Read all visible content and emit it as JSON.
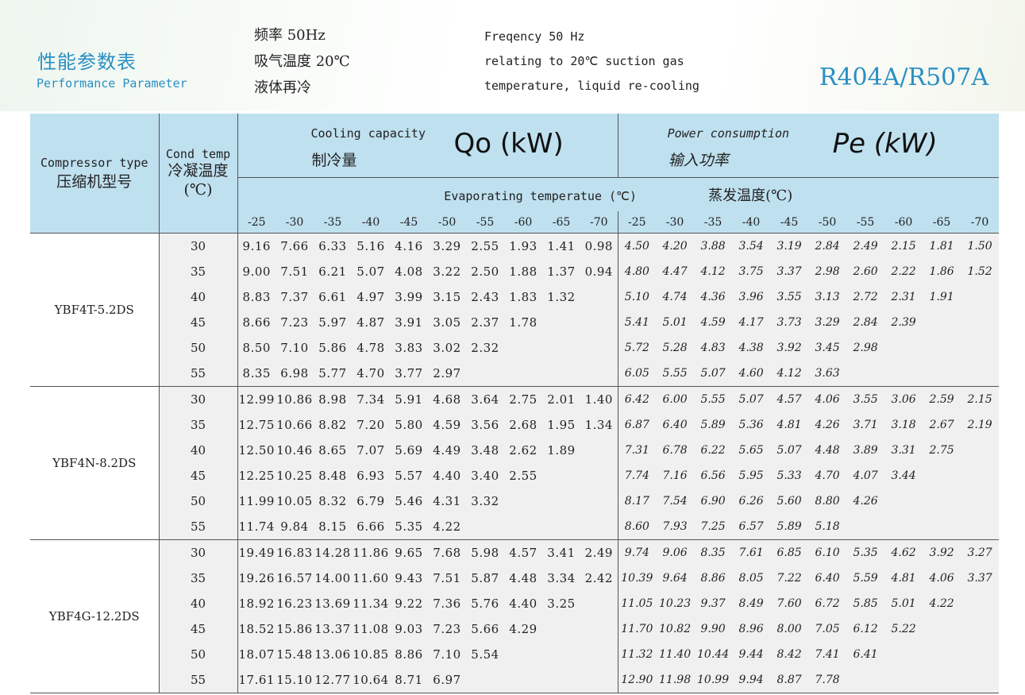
{
  "header": {
    "title_cn": "性能参数表",
    "title_en": "Performance Parameter",
    "conditions_cn": [
      "频率 50Hz",
      "吸气温度 20℃",
      "液体再冷"
    ],
    "conditions_en": [
      "Freqency 50 Hz",
      "relating to 20℃ suction gas",
      "temperature, liquid re-cooling"
    ],
    "refrigerant": "R404A/R507A"
  },
  "table": {
    "compressor_type_en": "Compressor type",
    "compressor_type_cn": "压缩机型号",
    "cond_temp_en": "Cond temp",
    "cond_temp_cn": "冷凝温度",
    "cond_temp_unit": "(℃)",
    "cooling_en": "Cooling capacity",
    "cooling_cn": "制冷量",
    "cooling_symbol": "Qo (kW)",
    "power_en": "Power consumption",
    "power_cn": "输入功率",
    "power_symbol": "Pe (kW)",
    "evap_en": "Evaporating temperatue (℃)",
    "evap_cn": "蒸发温度(℃)",
    "evap_temps": [
      "-25",
      "-30",
      "-35",
      "-40",
      "-45",
      "-50",
      "-55",
      "-60",
      "-65",
      "-70"
    ],
    "models": [
      {
        "name": "YBF4T-5.2DS",
        "rows": [
          {
            "t": "30",
            "q": [
              "9.16",
              "7.66",
              "6.33",
              "5.16",
              "4.16",
              "3.29",
              "2.55",
              "1.93",
              "1.41",
              "0.98"
            ],
            "p": [
              "4.50",
              "4.20",
              "3.88",
              "3.54",
              "3.19",
              "2.84",
              "2.49",
              "2.15",
              "1.81",
              "1.50"
            ]
          },
          {
            "t": "35",
            "q": [
              "9.00",
              "7.51",
              "6.21",
              "5.07",
              "4.08",
              "3.22",
              "2.50",
              "1.88",
              "1.37",
              "0.94"
            ],
            "p": [
              "4.80",
              "4.47",
              "4.12",
              "3.75",
              "3.37",
              "2.98",
              "2.60",
              "2.22",
              "1.86",
              "1.52"
            ]
          },
          {
            "t": "40",
            "q": [
              "8.83",
              "7.37",
              "6.61",
              "4.97",
              "3.99",
              "3.15",
              "2.43",
              "1.83",
              "1.32",
              ""
            ],
            "p": [
              "5.10",
              "4.74",
              "4.36",
              "3.96",
              "3.55",
              "3.13",
              "2.72",
              "2.31",
              "1.91",
              ""
            ]
          },
          {
            "t": "45",
            "q": [
              "8.66",
              "7.23",
              "5.97",
              "4.87",
              "3.91",
              "3.05",
              "2.37",
              "1.78",
              "",
              ""
            ],
            "p": [
              "5.41",
              "5.01",
              "4.59",
              "4.17",
              "3.73",
              "3.29",
              "2.84",
              "2.39",
              "",
              ""
            ]
          },
          {
            "t": "50",
            "q": [
              "8.50",
              "7.10",
              "5.86",
              "4.78",
              "3.83",
              "3.02",
              "2.32",
              "",
              "",
              ""
            ],
            "p": [
              "5.72",
              "5.28",
              "4.83",
              "4.38",
              "3.92",
              "3.45",
              "2.98",
              "",
              "",
              ""
            ]
          },
          {
            "t": "55",
            "q": [
              "8.35",
              "6.98",
              "5.77",
              "4.70",
              "3.77",
              "2.97",
              "",
              "",
              "",
              ""
            ],
            "p": [
              "6.05",
              "5.55",
              "5.07",
              "4.60",
              "4.12",
              "3.63",
              "",
              "",
              "",
              ""
            ]
          }
        ]
      },
      {
        "name": "YBF4N-8.2DS",
        "rows": [
          {
            "t": "30",
            "q": [
              "12.99",
              "10.86",
              "8.98",
              "7.34",
              "5.91",
              "4.68",
              "3.64",
              "2.75",
              "2.01",
              "1.40"
            ],
            "p": [
              "6.42",
              "6.00",
              "5.55",
              "5.07",
              "4.57",
              "4.06",
              "3.55",
              "3.06",
              "2.59",
              "2.15"
            ]
          },
          {
            "t": "35",
            "q": [
              "12.75",
              "10.66",
              "8.82",
              "7.20",
              "5.80",
              "4.59",
              "3.56",
              "2.68",
              "1.95",
              "1.34"
            ],
            "p": [
              "6.87",
              "6.40",
              "5.89",
              "5.36",
              "4.81",
              "4.26",
              "3.71",
              "3.18",
              "2.67",
              "2.19"
            ]
          },
          {
            "t": "40",
            "q": [
              "12.50",
              "10.46",
              "8.65",
              "7.07",
              "5.69",
              "4.49",
              "3.48",
              "2.62",
              "1.89",
              ""
            ],
            "p": [
              "7.31",
              "6.78",
              "6.22",
              "5.65",
              "5.07",
              "4.48",
              "3.89",
              "3.31",
              "2.75",
              ""
            ]
          },
          {
            "t": "45",
            "q": [
              "12.25",
              "10.25",
              "8.48",
              "6.93",
              "5.57",
              "4.40",
              "3.40",
              "2.55",
              "",
              ""
            ],
            "p": [
              "7.74",
              "7.16",
              "6.56",
              "5.95",
              "5.33",
              "4.70",
              "4.07",
              "3.44",
              "",
              ""
            ]
          },
          {
            "t": "50",
            "q": [
              "11.99",
              "10.05",
              "8.32",
              "6.79",
              "5.46",
              "4.31",
              "3.32",
              "",
              "",
              ""
            ],
            "p": [
              "8.17",
              "7.54",
              "6.90",
              "6.26",
              "5.60",
              "8.80",
              "4.26",
              "",
              "",
              ""
            ]
          },
          {
            "t": "55",
            "q": [
              "11.74",
              "9.84",
              "8.15",
              "6.66",
              "5.35",
              "4.22",
              "",
              "",
              "",
              ""
            ],
            "p": [
              "8.60",
              "7.93",
              "7.25",
              "6.57",
              "5.89",
              "5.18",
              "",
              "",
              "",
              ""
            ]
          }
        ]
      },
      {
        "name": "YBF4G-12.2DS",
        "rows": [
          {
            "t": "30",
            "q": [
              "19.49",
              "16.83",
              "14.28",
              "11.86",
              "9.65",
              "7.68",
              "5.98",
              "4.57",
              "3.41",
              "2.49"
            ],
            "p": [
              "9.74",
              "9.06",
              "8.35",
              "7.61",
              "6.85",
              "6.10",
              "5.35",
              "4.62",
              "3.92",
              "3.27"
            ]
          },
          {
            "t": "35",
            "q": [
              "19.26",
              "16.57",
              "14.00",
              "11.60",
              "9.43",
              "7.51",
              "5.87",
              "4.48",
              "3.34",
              "2.42"
            ],
            "p": [
              "10.39",
              "9.64",
              "8.86",
              "8.05",
              "7.22",
              "6.40",
              "5.59",
              "4.81",
              "4.06",
              "3.37"
            ]
          },
          {
            "t": "40",
            "q": [
              "18.92",
              "16.23",
              "13.69",
              "11.34",
              "9.22",
              "7.36",
              "5.76",
              "4.40",
              "3.25",
              ""
            ],
            "p": [
              "11.05",
              "10.23",
              "9.37",
              "8.49",
              "7.60",
              "6.72",
              "5.85",
              "5.01",
              "4.22",
              ""
            ]
          },
          {
            "t": "45",
            "q": [
              "18.52",
              "15.86",
              "13.37",
              "11.08",
              "9.03",
              "7.23",
              "5.66",
              "4.29",
              "",
              ""
            ],
            "p": [
              "11.70",
              "10.82",
              "9.90",
              "8.96",
              "8.00",
              "7.05",
              "6.12",
              "5.22",
              "",
              ""
            ]
          },
          {
            "t": "50",
            "q": [
              "18.07",
              "15.48",
              "13.06",
              "10.85",
              "8.86",
              "7.10",
              "5.54",
              "",
              "",
              ""
            ],
            "p": [
              "11.32",
              "11.40",
              "10.44",
              "9.44",
              "8.42",
              "7.41",
              "6.41",
              "",
              "",
              ""
            ]
          },
          {
            "t": "55",
            "q": [
              "17.61",
              "15.10",
              "12.77",
              "10.64",
              "8.71",
              "6.97",
              "",
              "",
              "",
              ""
            ],
            "p": [
              "12.90",
              "11.98",
              "10.99",
              "9.94",
              "8.87",
              "7.78",
              "",
              "",
              "",
              ""
            ]
          }
        ]
      }
    ]
  }
}
